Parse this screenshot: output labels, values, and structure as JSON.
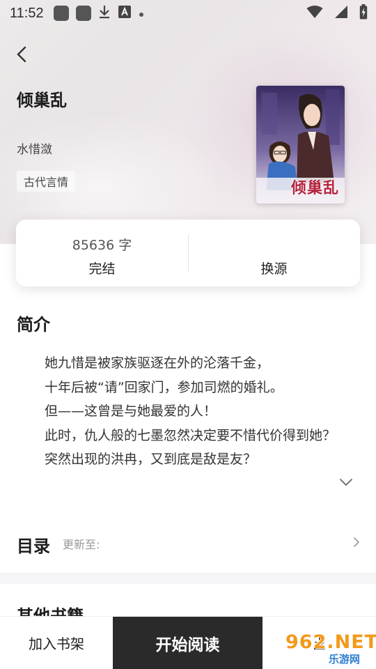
{
  "status_bar": {
    "time": "11:52",
    "icons": [
      "app-icon",
      "app-icon",
      "download-icon",
      "text-icon",
      "dot-icon",
      "wifi-icon",
      "signal-icon",
      "battery-charging-icon"
    ]
  },
  "book": {
    "title": "倾巢乱",
    "author": "水惜潋",
    "tag": "古代言情",
    "cover_title": "倾巢乱"
  },
  "info_card": {
    "word_count": "85636 字",
    "status": "完结",
    "source_label": "换源"
  },
  "intro": {
    "title": "简介",
    "lines": [
      "她九惜是被家族驱逐在外的沦落千金，",
      "十年后被“请”回家门，参加司燃的婚礼。",
      "但——这曾是与她最爱的人！",
      "此时，仇人般的七墨忽然决定要不惜代价得到她？",
      "突然出现的洪冉，又到底是敌是友？"
    ]
  },
  "toc": {
    "title": "目录",
    "update_label": "更新至:"
  },
  "other_books": {
    "title": "其他书籍"
  },
  "bottom_bar": {
    "add_shelf": "加入书架",
    "start_reading": "开始阅读"
  },
  "watermark": {
    "main": "962.NET",
    "sub": "乐游网"
  },
  "colors": {
    "primary_button": "#2a2a2a",
    "watermark_orange": "#f29a1c",
    "watermark_blue": "#2f7fd0",
    "cover_title": "#b4233e"
  }
}
